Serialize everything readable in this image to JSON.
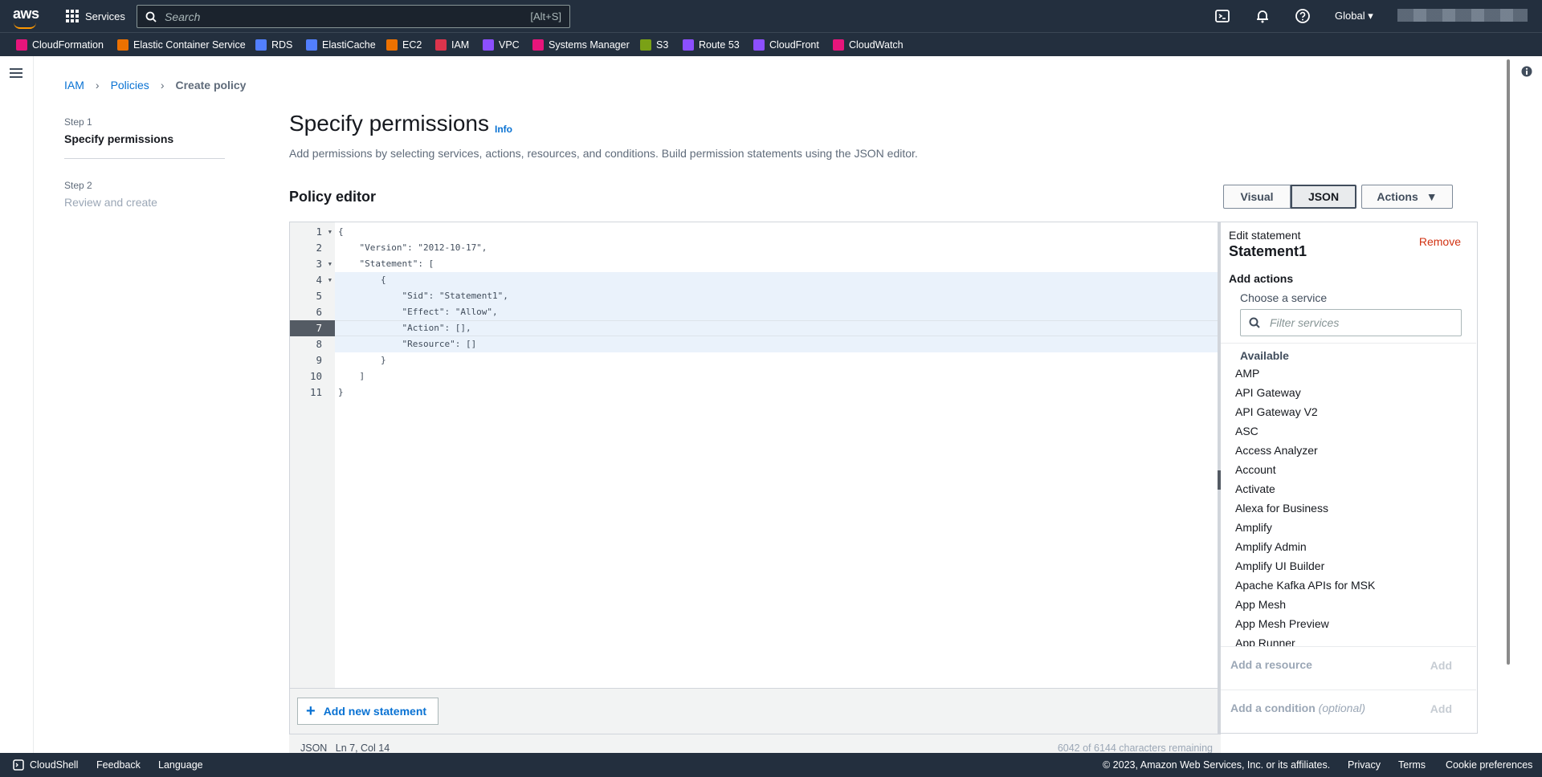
{
  "topnav": {
    "logo": "aws",
    "services_label": "Services",
    "search_placeholder": "Search",
    "search_shortcut": "[Alt+S]",
    "region": "Global"
  },
  "favorites": [
    {
      "label": "CloudFormation",
      "color": "#e7157b"
    },
    {
      "label": "Elastic Container Service",
      "color": "#ed7100"
    },
    {
      "label": "RDS",
      "color": "#527fff"
    },
    {
      "label": "ElastiCache",
      "color": "#527fff"
    },
    {
      "label": "EC2",
      "color": "#ed7100"
    },
    {
      "label": "IAM",
      "color": "#dd344c"
    },
    {
      "label": "VPC",
      "color": "#8c4fff"
    },
    {
      "label": "Systems Manager",
      "color": "#e7157b"
    },
    {
      "label": "S3",
      "color": "#7aa116"
    },
    {
      "label": "Route 53",
      "color": "#8c4fff"
    },
    {
      "label": "CloudFront",
      "color": "#8c4fff"
    },
    {
      "label": "CloudWatch",
      "color": "#e7157b"
    }
  ],
  "breadcrumb": {
    "iam": "IAM",
    "policies": "Policies",
    "current": "Create policy"
  },
  "steps": {
    "step1_label": "Step 1",
    "step1_title": "Specify permissions",
    "step2_label": "Step 2",
    "step2_title": "Review and create"
  },
  "page": {
    "title": "Specify permissions",
    "info": "Info",
    "description": "Add permissions by selecting services, actions, resources, and conditions. Build permission statements using the JSON editor."
  },
  "editor": {
    "title": "Policy editor",
    "visual_label": "Visual",
    "json_label": "JSON",
    "actions_label": "Actions",
    "line_numbers": [
      "1",
      "2",
      "3",
      "4",
      "5",
      "6",
      "7",
      "8",
      "9",
      "10",
      "11"
    ],
    "code_lines": [
      "{",
      "    \"Version\": \"2012-10-17\",",
      "    \"Statement\": [",
      "        {",
      "            \"Sid\": \"Statement1\",",
      "            \"Effect\": \"Allow\",",
      "            \"Action\": [],",
      "            \"Resource\": []",
      "        }",
      "    ]",
      "}"
    ],
    "add_statement": "Add new statement",
    "status_left": "JSON   Ln 7, Col 14",
    "status_right": "6042 of 6144 characters remaining"
  },
  "panel": {
    "edit_label": "Edit statement",
    "statement_name": "Statement1",
    "remove_label": "Remove",
    "add_actions": "Add actions",
    "choose_service": "Choose a service",
    "filter_placeholder": "Filter services",
    "available": "Available",
    "services": [
      "AMP",
      "API Gateway",
      "API Gateway V2",
      "ASC",
      "Access Analyzer",
      "Account",
      "Activate",
      "Alexa for Business",
      "Amplify",
      "Amplify Admin",
      "Amplify UI Builder",
      "Apache Kafka APIs for MSK",
      "App Mesh",
      "App Mesh Preview",
      "App Runner"
    ],
    "add_resource": "Add a resource",
    "add_condition": "Add a condition",
    "optional": "(optional)",
    "add_label": "Add"
  },
  "footer": {
    "cloudshell": "CloudShell",
    "feedback": "Feedback",
    "language": "Language",
    "copyright": "© 2023, Amazon Web Services, Inc. or its affiliates.",
    "privacy": "Privacy",
    "terms": "Terms",
    "cookies": "Cookie preferences"
  }
}
